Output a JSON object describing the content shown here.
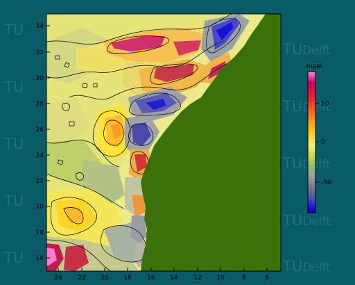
{
  "map": {
    "y_ticks": [
      "34",
      "32",
      "30",
      "28",
      "26",
      "24",
      "22",
      "20",
      "18",
      "16"
    ],
    "x_ticks": [
      "24",
      "22",
      "20",
      "18",
      "16",
      "14",
      "12",
      "10",
      "8",
      "6"
    ],
    "land_color": "#3b700a",
    "background_color": "#0b5a68",
    "watermark": {
      "tu": "TU",
      "delft": "Delft"
    }
  },
  "colorbar": {
    "unit": "mgal",
    "ticks": [
      "50",
      "0",
      "-50"
    ],
    "colors": [
      "#ff88e0",
      "#d00060",
      "#f02828",
      "#ff8c1c",
      "#ffd020",
      "#f3f07a",
      "#c8d84a",
      "#8fbf6a",
      "#9aa0a2",
      "#7e7e88",
      "#5a5aa4",
      "#2a2ad0",
      "#0000c8"
    ]
  }
}
